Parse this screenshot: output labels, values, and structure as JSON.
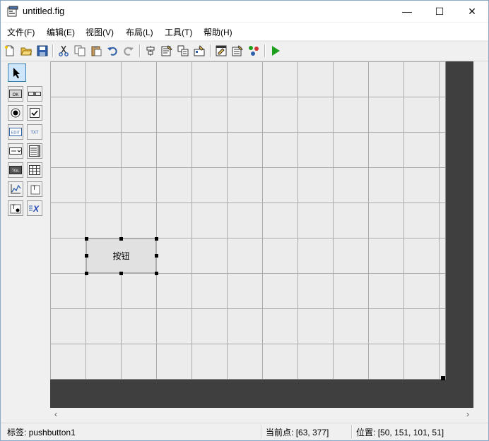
{
  "window": {
    "title": "untitled.fig",
    "controls": {
      "minimize": "—",
      "maximize": "☐",
      "close": "✕"
    }
  },
  "menu": [
    "文件(F)",
    "编辑(E)",
    "视图(V)",
    "布局(L)",
    "工具(T)",
    "帮助(H)"
  ],
  "toolbar": {
    "icons": [
      "new-file-icon",
      "open-folder-icon",
      "save-icon",
      "cut-icon",
      "copy-icon",
      "paste-icon",
      "undo-icon",
      "redo-icon",
      "align-objects-icon",
      "menu-editor-icon",
      "tab-order-editor-icon",
      "toolbar-editor-icon",
      "editor-icon",
      "property-inspector-icon",
      "object-browser-icon",
      "run-figure-icon"
    ]
  },
  "palette": {
    "items": [
      {
        "name": "select-tool",
        "label": ""
      },
      {
        "name": "push-button-tool",
        "label": "OK"
      },
      {
        "name": "slider-tool",
        "label": ""
      },
      {
        "name": "radio-button-tool",
        "label": ""
      },
      {
        "name": "check-box-tool",
        "label": ""
      },
      {
        "name": "edit-text-tool",
        "label": "EDIT"
      },
      {
        "name": "static-text-tool",
        "label": "TXT"
      },
      {
        "name": "popup-menu-tool",
        "label": ""
      },
      {
        "name": "listbox-tool",
        "label": ""
      },
      {
        "name": "toggle-button-tool",
        "label": "TGL"
      },
      {
        "name": "table-tool",
        "label": ""
      },
      {
        "name": "axes-tool",
        "label": ""
      },
      {
        "name": "panel-tool",
        "label": "T"
      },
      {
        "name": "button-group-tool",
        "label": "T"
      },
      {
        "name": "activex-tool",
        "label": "X"
      }
    ]
  },
  "canvas": {
    "button": {
      "label": "按钮"
    }
  },
  "scroll": {
    "left": "‹",
    "right": "›"
  },
  "status": {
    "tag_label": "标签:",
    "tag_value": "pushbutton1",
    "current_point_label": "当前点:",
    "current_point_value": "[63, 377]",
    "position_label": "位置:",
    "position_value": "[50, 151, 101, 51]"
  },
  "colors": {
    "canvas_background": "#3f3f3f",
    "grid_background": "#ececec",
    "grid_line": "#ababab",
    "run_green": "#1ea01e"
  }
}
